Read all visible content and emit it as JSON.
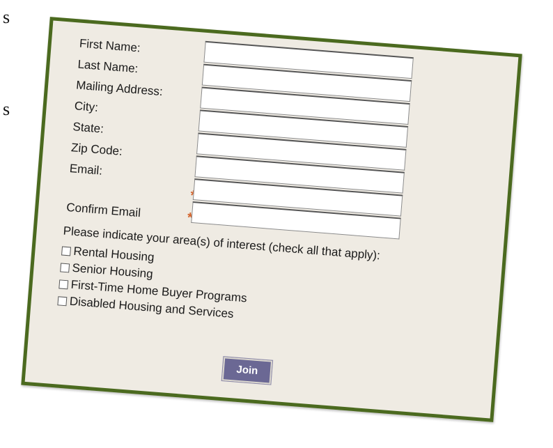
{
  "background_fragments": [
    "s",
    "s"
  ],
  "form": {
    "fields": [
      {
        "label": "First Name:",
        "value": "",
        "required": false
      },
      {
        "label": "Last Name:",
        "value": "",
        "required": false
      },
      {
        "label": "Mailing Address:",
        "value": "",
        "required": false
      },
      {
        "label": "City:",
        "value": "",
        "required": false
      },
      {
        "label": "State:",
        "value": "",
        "required": false
      },
      {
        "label": "Zip Code:",
        "value": "",
        "required": false
      },
      {
        "label": "Email:",
        "value": "",
        "required": true
      },
      {
        "label": "Confirm Email",
        "value": "",
        "required": true
      }
    ],
    "required_marker": "*",
    "interest_prompt": "Please indicate your area(s) of interest (check all that apply):",
    "interests": [
      {
        "label": "Rental Housing",
        "checked": false
      },
      {
        "label": "Senior Housing",
        "checked": false
      },
      {
        "label": "First-Time Home Buyer Programs",
        "checked": false
      },
      {
        "label": "Disabled Housing and Services",
        "checked": false
      }
    ],
    "submit_label": "Join"
  },
  "colors": {
    "card_background": "#efebe3",
    "card_border": "#4b6a1f",
    "required_marker": "#d4622a",
    "button": "#6b6894"
  }
}
